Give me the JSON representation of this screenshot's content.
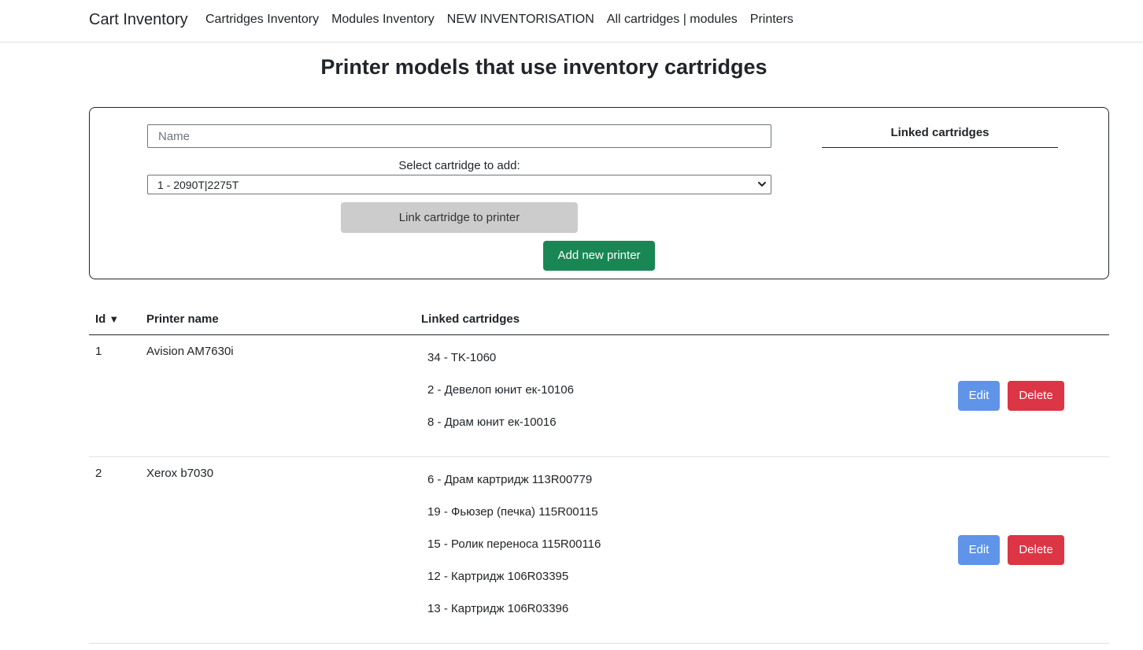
{
  "navbar": {
    "brand": "Cart Inventory",
    "links": [
      "Cartridges Inventory",
      "Modules Inventory",
      "NEW INVENTORISATION",
      "All cartridges | modules",
      "Printers"
    ]
  },
  "page_title": "Printer models that use inventory cartridges",
  "form": {
    "name_placeholder": "Name",
    "name_value": "",
    "select_label": "Select cartridge to add:",
    "select_value": "1 - 2090T|2275T",
    "link_button": "Link cartridge to printer",
    "add_button": "Add new printer",
    "linked_title": "Linked cartridges"
  },
  "table": {
    "headers": {
      "id": "Id",
      "sort_indicator": "▼",
      "name": "Printer name",
      "linked": "Linked cartridges"
    },
    "edit_label": "Edit",
    "delete_label": "Delete",
    "rows": [
      {
        "id": "1",
        "name": "Avision AM7630i",
        "cartridges": [
          "34 - TK-1060",
          "2 - Девелоп юнит ек-10106",
          "8 - Драм юнит ек-10016"
        ]
      },
      {
        "id": "2",
        "name": "Xerox b7030",
        "cartridges": [
          "6 - Драм картридж 113R00779",
          "19 - Фьюзер (печка) 115R00115",
          "15 - Ролик переноса 115R00116",
          "12 - Картридж 106R03395",
          "13 - Картридж 106R03396"
        ]
      }
    ]
  }
}
